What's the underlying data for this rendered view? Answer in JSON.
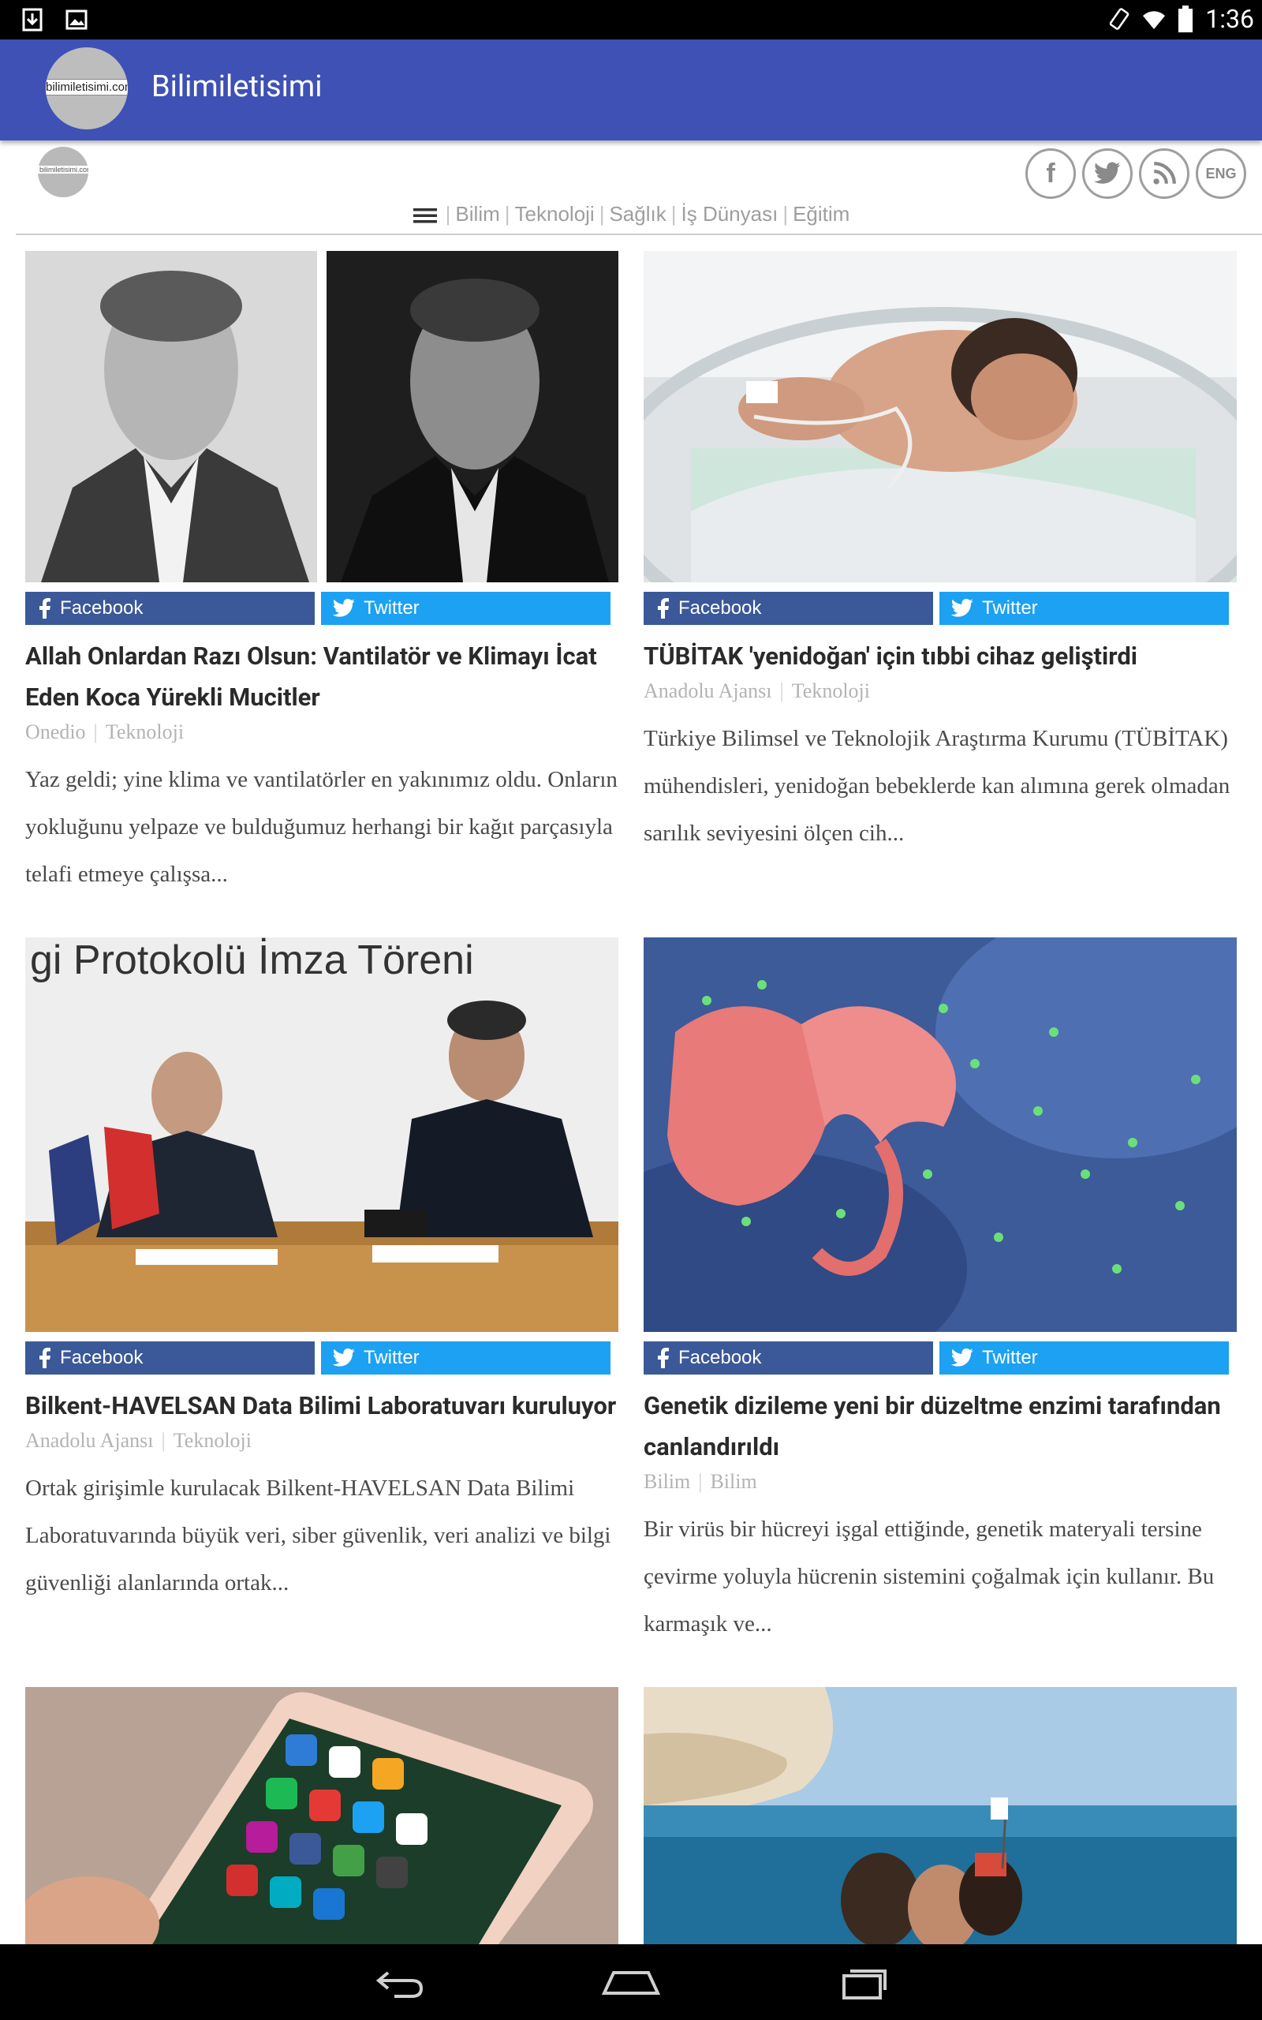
{
  "status_bar": {
    "time": "1:36"
  },
  "app_bar": {
    "title": "Bilimiletisimi",
    "logo_text": "bilimiletisimi.com"
  },
  "site_header": {
    "logo_text": "bilimiletisimi.com",
    "social": {
      "facebook": "f",
      "twitter": "t",
      "rss": "rss",
      "language": "ENG"
    }
  },
  "nav": {
    "items": [
      {
        "label": "Bilim"
      },
      {
        "label": "Teknoloji"
      },
      {
        "label": "Sağlık"
      },
      {
        "label": "İş Dünyası"
      },
      {
        "label": "Eğitim"
      }
    ]
  },
  "share": {
    "facebook_label": "Facebook",
    "twitter_label": "Twitter"
  },
  "cards": [
    {
      "title": "Allah Onlardan Razı Olsun: Vantilatör ve Klimayı İcat Eden Koca Yürekli Mucitler",
      "source": "Onedio",
      "category": "Teknoloji",
      "excerpt": "Yaz geldi; yine klima ve vantilatörler en yakınımız oldu. Onların yokluğunu yelpaze ve bulduğumuz herhangi bir kağıt parçasıyla telafi etmeye çalışsa..."
    },
    {
      "title": "TÜBİTAK 'yenidoğan' için tıbbi cihaz geliştirdi",
      "source": "Anadolu Ajansı",
      "category": "Teknoloji",
      "excerpt": "Türkiye Bilimsel ve Teknolojik Araştırma Kurumu (TÜBİTAK) mühendisleri, yenidoğan bebeklerde kan alımına gerek olmadan sarılık seviyesini ölçen cih..."
    },
    {
      "title": "Bilkent-HAVELSAN Data Bilimi Laboratuvarı kuruluyor",
      "source": "Anadolu Ajansı",
      "category": "Teknoloji",
      "excerpt": "Ortak girişimle kurulacak Bilkent-HAVELSAN Data Bilimi Laboratuvarında büyük veri, siber güvenlik, veri analizi ve bilgi güvenliği alanlarında ortak...",
      "image_text": "gi Protokolü İmza Töreni"
    },
    {
      "title": "Genetik dizileme yeni bir düzeltme enzimi tarafından canlandırıldı",
      "source": "Bilim",
      "category": "Bilim",
      "excerpt": "Bir virüs bir hücreyi işgal ettiğinde, genetik materyali tersine çevirme yoluyla hücrenin sistemini çoğalmak için kullanır. Bu karmaşık ve..."
    }
  ]
}
